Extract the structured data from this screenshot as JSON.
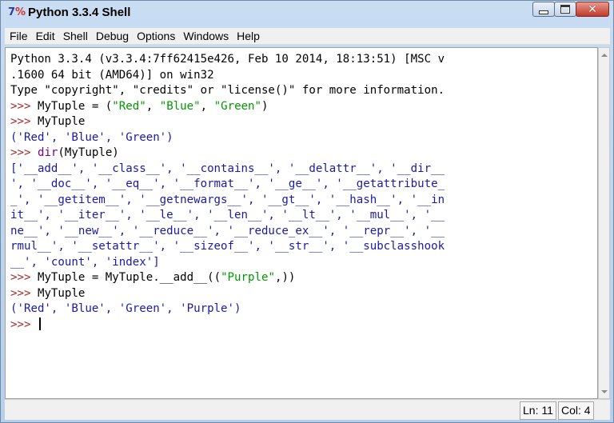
{
  "window": {
    "title": "Python 3.3.4 Shell",
    "icon": "python-idle-icon"
  },
  "menu": [
    "File",
    "Edit",
    "Shell",
    "Debug",
    "Options",
    "Windows",
    "Help"
  ],
  "console": {
    "banner_line1": "Python 3.3.4 (v3.3.4:7ff62415e426, Feb 10 2014, 18:13:51) [MSC v",
    "banner_line2": ".1600 64 bit (AMD64)] on win32",
    "banner_line3": "Type \"copyright\", \"credits\" or \"license()\" for more information.",
    "prompt": ">>> ",
    "cmd1_pre": "MyTuple = (",
    "cmd1_str1": "\"Red\"",
    "cmd1_sep1": ", ",
    "cmd1_str2": "\"Blue\"",
    "cmd1_sep2": ", ",
    "cmd1_str3": "\"Green\"",
    "cmd1_post": ")",
    "cmd2": "MyTuple",
    "out2": "('Red', 'Blue', 'Green')",
    "cmd3_fn": "dir",
    "cmd3_args": "(MyTuple)",
    "dir_lines": [
      "['__add__', '__class__', '__contains__', '__delattr__', '__dir__",
      "', '__doc__', '__eq__', '__format__', '__ge__', '__getattribute_",
      "_', '__getitem__', '__getnewargs__', '__gt__', '__hash__', '__in",
      "it__', '__iter__', '__le__', '__len__', '__lt__', '__mul__', '__",
      "ne__', '__new__', '__reduce__', '__reduce_ex__', '__repr__', '__",
      "rmul__', '__setattr__', '__sizeof__', '__str__', '__subclasshook",
      "__', 'count', 'index']"
    ],
    "cmd4_pre": "MyTuple = MyTuple.__add__((",
    "cmd4_str": "\"Purple\"",
    "cmd4_post": ",))",
    "cmd5": "MyTuple",
    "out5": "('Red', 'Blue', 'Green', 'Purple')"
  },
  "status": {
    "line": "Ln: 11",
    "col": "Col: 4"
  },
  "colors": {
    "prompt": "#a52a2a",
    "string": "#009900",
    "output": "#1a1aa6",
    "builtin": "#800080"
  }
}
